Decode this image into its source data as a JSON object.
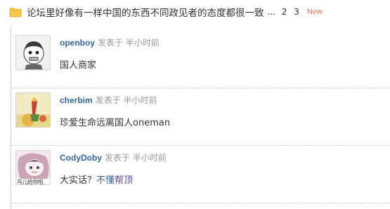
{
  "thread": {
    "title": "论坛里好像有一样中国的东西不同政见者的态度都很一致",
    "pager_dots": "...",
    "pages": [
      "2",
      "3"
    ],
    "new_badge": "New",
    "folder_color": "#f5c542"
  },
  "replies": [
    {
      "author": "openboy",
      "posted": "发表于 半小时前",
      "message": "国人商家"
    },
    {
      "author": "cherbim",
      "posted": "发表于 半小时前",
      "message": "珍爱生命远离国人oneman"
    },
    {
      "author": "CodyDoby",
      "posted": "发表于 半小时前",
      "message_prefix": "大实话？",
      "message_link1": "不懂",
      "message_link2": "帮顶",
      "avatar_text": "鸟儿给你啦"
    }
  ],
  "colors": {
    "author": "#336699",
    "meta": "#999999",
    "new_badge": "#f26c4f",
    "border": "#cdcdcd"
  }
}
